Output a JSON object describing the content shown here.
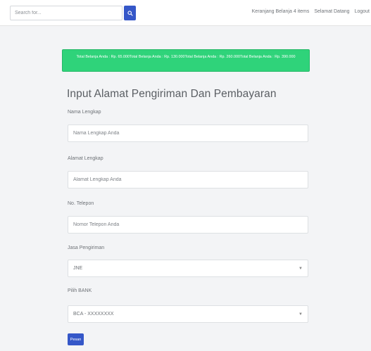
{
  "header": {
    "search_placeholder": "Search for...",
    "nav": {
      "cart": "Keranjang Belanja",
      "items": "4 items",
      "welcome": "Selamat Datang",
      "logout": "Logout"
    }
  },
  "alert": {
    "text": "Total Belanja Anda : Rp. 65.000Total Belanja Anda : Rp. 130.000Total Belanja Anda : Rp. 260.000Total Belanja Anda : Rp. 390.000"
  },
  "form": {
    "title": "Input Alamat Pengiriman Dan Pembayaran",
    "nama": {
      "label": "Nama Lengkap",
      "placeholder": "Nama Lengkap Anda"
    },
    "alamat": {
      "label": "Alamat Lengkap",
      "placeholder": "Alamat Lengkap Anda"
    },
    "telepon": {
      "label": "No. Telepon",
      "placeholder": "Nomor Telepon Anda"
    },
    "jasa": {
      "label": "Jasa Pengiriman",
      "value": "JNE"
    },
    "bank": {
      "label": "Pilih BANK",
      "value": "BCA - XXXXXXXX"
    },
    "submit_label": "Pesan"
  },
  "colors": {
    "primary": "#3557c8",
    "success": "#2fd37a"
  }
}
